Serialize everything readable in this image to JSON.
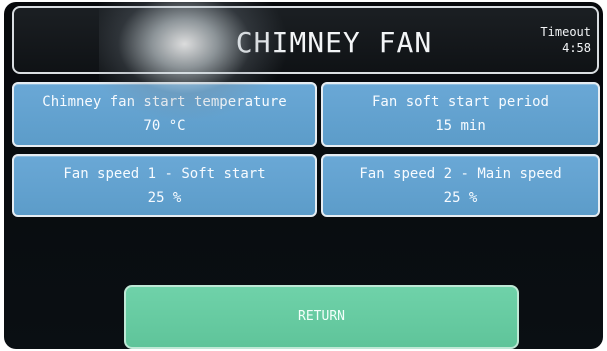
{
  "header": {
    "title": "CHIMNEY FAN",
    "timeout_label": "Timeout",
    "timeout_value": "4:58"
  },
  "tiles": [
    {
      "label": "Chimney fan start temperature",
      "value": "70 °C"
    },
    {
      "label": "Fan soft start period",
      "value": "15 min"
    },
    {
      "label": "Fan speed 1 - Soft start",
      "value": "25 %"
    },
    {
      "label": "Fan speed 2 - Main speed",
      "value": "25 %"
    }
  ],
  "footer": {
    "return_label": "RETURN"
  },
  "colors": {
    "tile_blue": "#5c9cc9",
    "return_green": "#5fc49a",
    "screen_bg": "#0a0f13"
  }
}
